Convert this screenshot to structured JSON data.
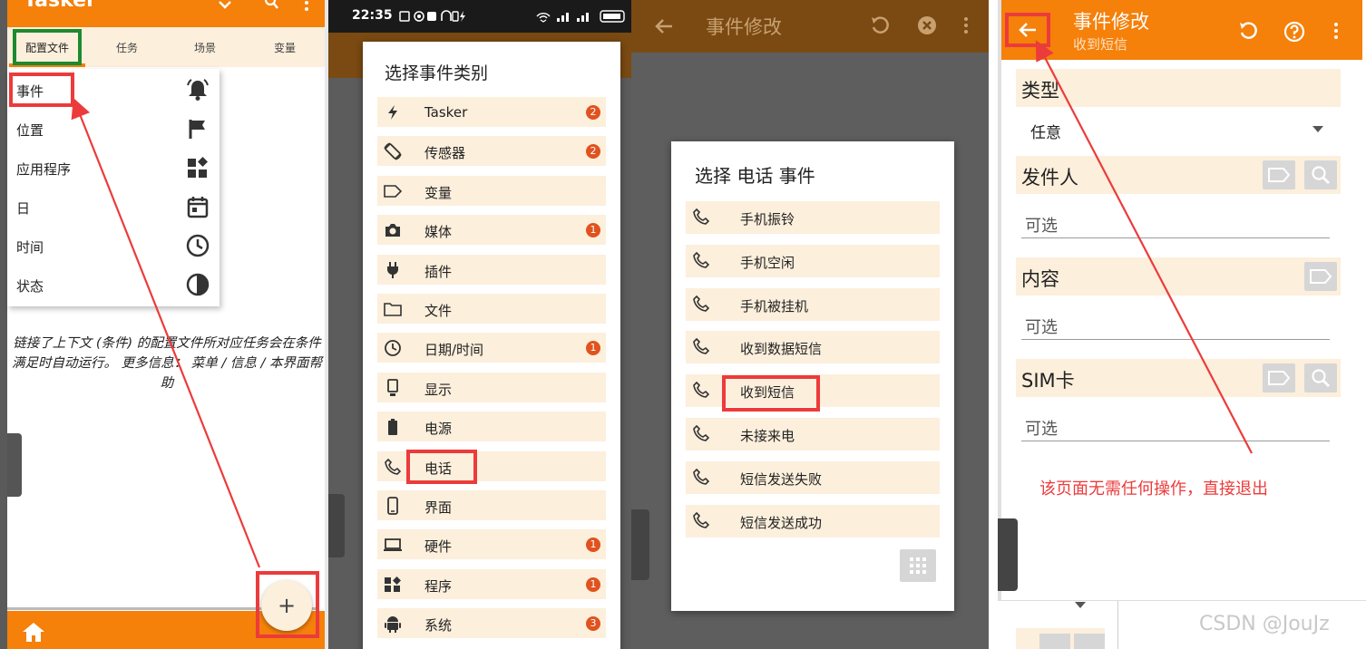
{
  "panel1": {
    "app_title": "Tasker",
    "tabs": [
      "配置文件",
      "任务",
      "场景",
      "变量"
    ],
    "menu": [
      "事件",
      "位置",
      "应用程序",
      "日",
      "时间",
      "状态"
    ],
    "help_text": "链接了上下文 (条件) 的配置文件所对应任务会在条件满足时自动运行。 更多信息： 菜单 / 信息 / 本界面帮助",
    "fab": "+"
  },
  "panel2": {
    "status_time": "22:35",
    "dialog_title": "选择事件类别",
    "items": [
      {
        "label": "Tasker",
        "icon": "bolt-icon",
        "badge": "2"
      },
      {
        "label": "传感器",
        "icon": "rotate-icon",
        "badge": "2"
      },
      {
        "label": "变量",
        "icon": "tag-icon",
        "badge": ""
      },
      {
        "label": "媒体",
        "icon": "camera-icon",
        "badge": "1"
      },
      {
        "label": "插件",
        "icon": "plug-icon",
        "badge": ""
      },
      {
        "label": "文件",
        "icon": "folder-icon",
        "badge": ""
      },
      {
        "label": "日期/时间",
        "icon": "clock-icon",
        "badge": "1"
      },
      {
        "label": "显示",
        "icon": "display-icon",
        "badge": ""
      },
      {
        "label": "电源",
        "icon": "battery-icon",
        "badge": ""
      },
      {
        "label": "电话",
        "icon": "phone-icon",
        "badge": ""
      },
      {
        "label": "界面",
        "icon": "phone-screen-icon",
        "badge": ""
      },
      {
        "label": "硬件",
        "icon": "laptop-icon",
        "badge": "1"
      },
      {
        "label": "程序",
        "icon": "widgets-icon",
        "badge": "1"
      },
      {
        "label": "系统",
        "icon": "android-icon",
        "badge": "3"
      }
    ]
  },
  "panel3": {
    "header_title": "事件修改",
    "dialog_title": "选择 电话 事件",
    "items": [
      "手机振铃",
      "手机空闲",
      "手机被挂机",
      "收到数据短信",
      "收到短信",
      "未接来电",
      "短信发送失败",
      "短信发送成功"
    ]
  },
  "panel4": {
    "title": "事件修改",
    "subtitle": "收到短信",
    "type_label": "类型",
    "type_value": "任意",
    "sender_label": "发件人",
    "content_label": "内容",
    "sim_label": "SIM卡",
    "placeholder": "可选",
    "annotation": "该页面无需任何操作，直接退出"
  },
  "watermark": "CSDN @JouJz",
  "colors": {
    "accent": "#f5800a",
    "highlight": "#ec3b3b",
    "row_bg": "#fcefdc",
    "badge": "#e0521f"
  }
}
